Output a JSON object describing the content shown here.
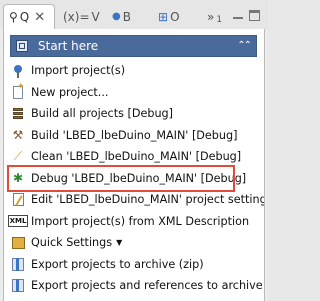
{
  "tabs": [
    {
      "glyph": "⚲",
      "title": "Q",
      "close": "✕",
      "icon": "quick-access-icon"
    },
    {
      "glyph": "(x)=",
      "title": "V",
      "icon": "variables-icon"
    },
    {
      "glyph": "●",
      "title": "B",
      "icon": "breakpoints-icon"
    },
    {
      "glyph": "⊞",
      "title": "O",
      "icon": "outline-icon"
    },
    {
      "glyph": "»",
      "title": "1",
      "icon": "overflow-icon"
    }
  ],
  "header": {
    "title": "Start here",
    "collapse_glyph": "⌃⌃"
  },
  "items": [
    {
      "label": "Import project(s)",
      "icon": "import-project-icon"
    },
    {
      "label": "New project...",
      "icon": "new-project-icon"
    },
    {
      "label": "Build all projects [Debug]",
      "icon": "build-all-icon"
    },
    {
      "label": "Build 'LBED_lbeDuino_MAIN' [Debug]",
      "icon": "hammer-icon"
    },
    {
      "label": "Clean 'LBED_lbeDuino_MAIN' [Debug]",
      "icon": "broom-icon"
    },
    {
      "label": "Debug 'LBED_lbeDuino_MAIN' [Debug]",
      "icon": "bug-icon"
    },
    {
      "label": "Edit 'LBED_lbeDuino_MAIN' project setting",
      "icon": "edit-settings-icon"
    },
    {
      "label": "Import project(s) from XML Description",
      "icon": "xml-icon"
    },
    {
      "label": "Quick Settings",
      "icon": "quick-settings-icon",
      "caret": "▼"
    },
    {
      "label": "Export projects to archive (zip)",
      "icon": "export-archive-icon"
    },
    {
      "label": "Export projects and references to archive",
      "icon": "export-archive-refs-icon"
    }
  ]
}
